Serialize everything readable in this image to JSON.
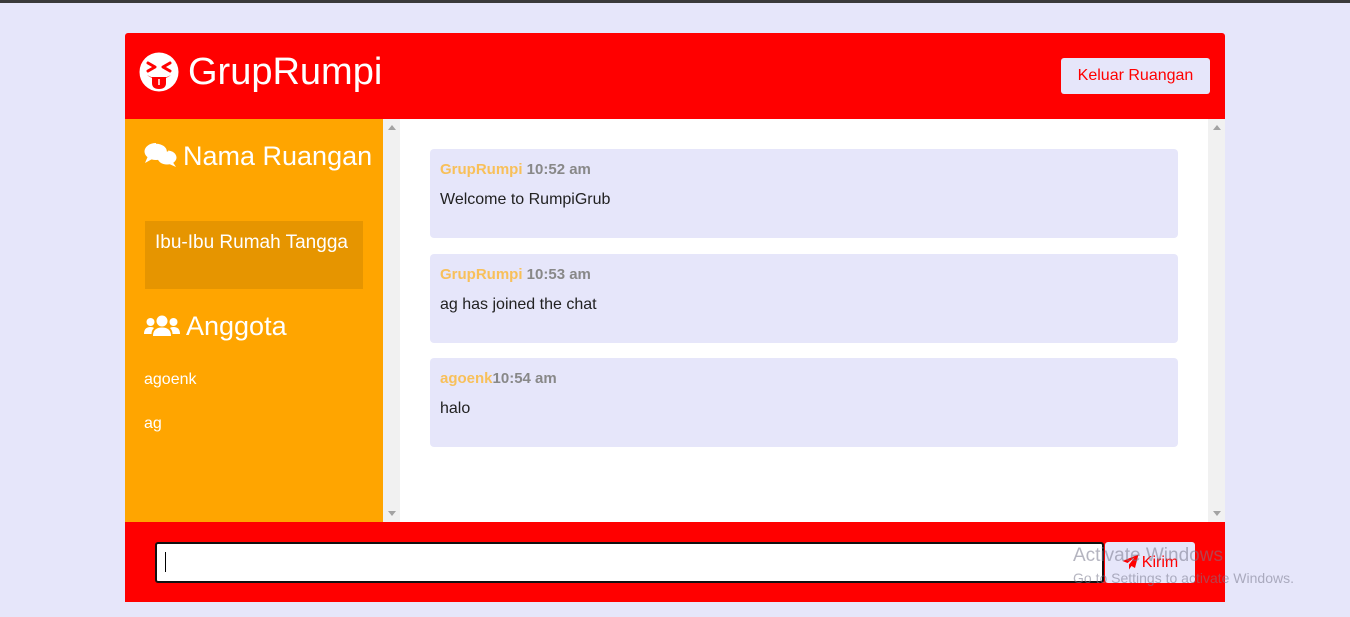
{
  "header": {
    "brand_icon": "grin-squint-tongue-icon",
    "title": "GrupRumpi",
    "leave_button": "Keluar Ruangan"
  },
  "sidebar": {
    "room_heading": "Nama Ruangan",
    "room_icon": "comments-icon",
    "room_name": "Ibu-Ibu Rumah Tangga",
    "members_heading": "Anggota",
    "members_icon": "users-icon",
    "members": [
      "agoenk",
      "ag"
    ]
  },
  "messages": [
    {
      "user": "GrupRumpi",
      "time": "10:52 am",
      "text": "Welcome to RumpiGrub"
    },
    {
      "user": "GrupRumpi",
      "time": "10:53 am",
      "text": "ag has joined the chat"
    },
    {
      "user": "agoenk",
      "time": "10:54 am",
      "text": "halo"
    }
  ],
  "composer": {
    "input_value": "",
    "send_label": "Kirim",
    "send_icon": "paper-plane-icon"
  },
  "watermark": {
    "line1": "Activate Windows",
    "line2": "Go to Settings to activate Windows."
  },
  "colors": {
    "header": "#ff0000",
    "sidebar": "#ffa500",
    "room_box": "#e69500",
    "page_bg": "#e6e6fa",
    "username": "#f8c05a"
  }
}
